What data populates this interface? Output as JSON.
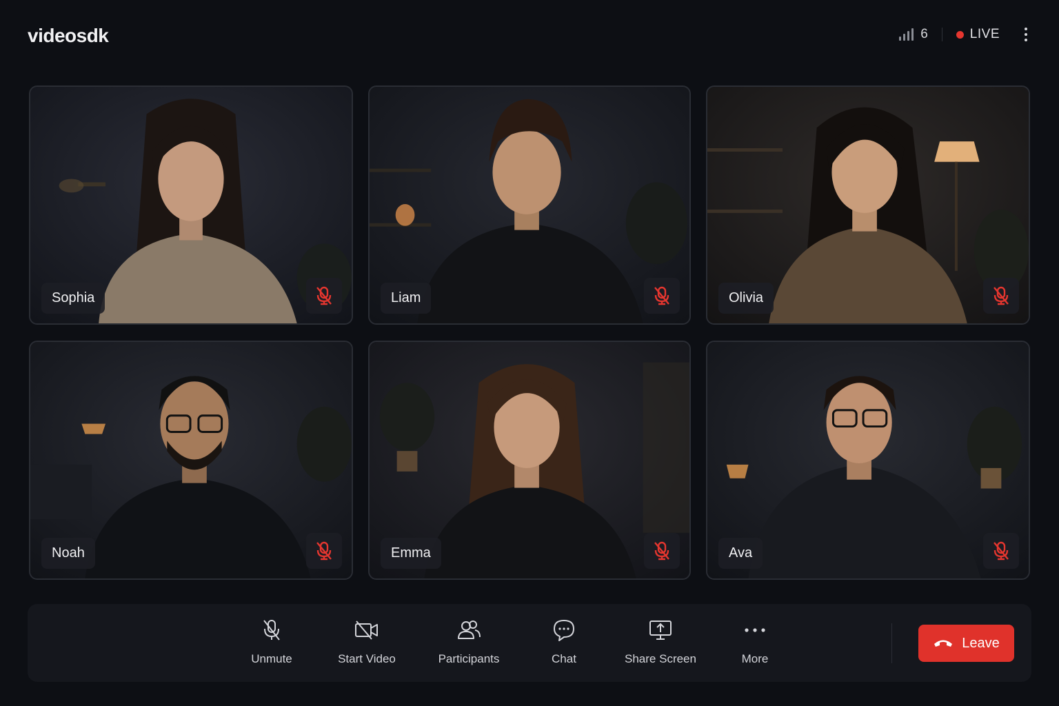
{
  "header": {
    "logo": "videosdk",
    "participant_count": "6",
    "live_label": "LIVE"
  },
  "participants": [
    {
      "name": "Sophia",
      "muted": true
    },
    {
      "name": "Liam",
      "muted": true
    },
    {
      "name": "Olivia",
      "muted": true
    },
    {
      "name": "Noah",
      "muted": true
    },
    {
      "name": "Emma",
      "muted": true
    },
    {
      "name": "Ava",
      "muted": true
    }
  ],
  "controls": {
    "unmute": "Unmute",
    "start_video": "Start Video",
    "participants": "Participants",
    "chat": "Chat",
    "share_screen": "Share Screen",
    "more": "More",
    "leave": "Leave"
  },
  "colors": {
    "background": "#0d0f14",
    "live_dot": "#e5362f",
    "leave_button": "#e0322b",
    "mute_icon": "#e5362f"
  }
}
